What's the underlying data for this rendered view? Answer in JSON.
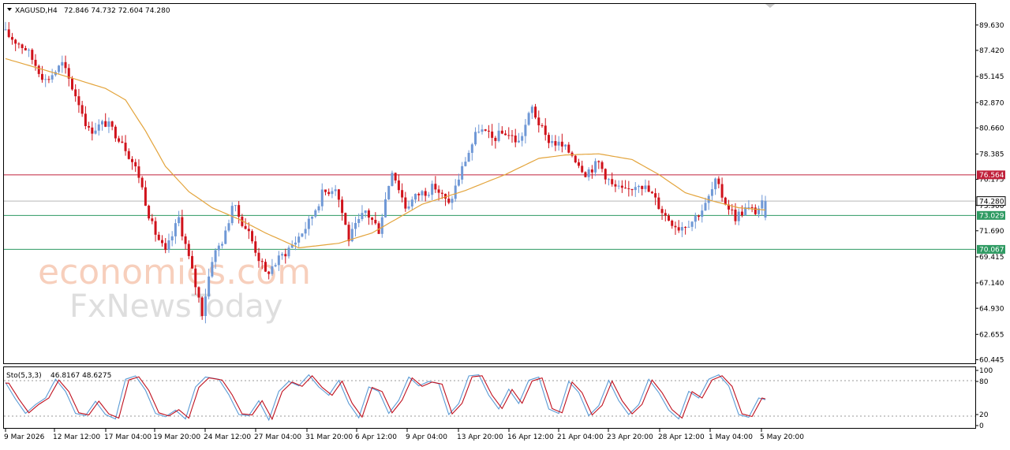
{
  "header": {
    "symbol_timeframe": "XAGUSD,H4",
    "ohlc": "72.846 74.732 72.604 74.280"
  },
  "watermark": {
    "line1": "economies.com",
    "line2": "FxNewsToday"
  },
  "colors": {
    "bull": "#6f98d6",
    "bear": "#d0121b",
    "moving_average": "#e3a43c",
    "resistance": "#c0213b",
    "support": "#2e9a62",
    "current_price": "#b8b8b8",
    "stoch_main": "#5b9bd5",
    "stoch_signal": "#c0101e"
  },
  "chart_data": [
    {
      "type": "candlestick",
      "title": "XAGUSD,H4",
      "ohlc_last": {
        "open": 72.846,
        "high": 74.732,
        "low": 72.604,
        "close": 74.28
      },
      "y_ticks": [
        89.63,
        87.42,
        85.145,
        82.87,
        80.66,
        78.385,
        76.175,
        73.9,
        71.69,
        69.415,
        67.14,
        64.93,
        62.655,
        60.445
      ],
      "ylim": [
        60.2,
        91.4
      ],
      "x_ticks": [
        "9 Mar 2026",
        "12 Mar 12:00",
        "17 Mar 04:00",
        "19 Mar 20:00",
        "24 Mar 12:00",
        "27 Mar 04:00",
        "31 Mar 20:00",
        "6 Apr 12:00",
        "9 Apr 04:00",
        "13 Apr 20:00",
        "16 Apr 12:00",
        "21 Apr 04:00",
        "23 Apr 20:00",
        "28 Apr 12:00",
        "1 May 04:00",
        "5 May 20:00"
      ],
      "close_path": [
        [
          0,
          88.9
        ],
        [
          6,
          87.6
        ],
        [
          12,
          84.8
        ],
        [
          17,
          86.2
        ],
        [
          22,
          82.9
        ],
        [
          25,
          80.4
        ],
        [
          30,
          81.1
        ],
        [
          35,
          79.6
        ],
        [
          40,
          76.5
        ],
        [
          44,
          72.1
        ],
        [
          48,
          69.7
        ],
        [
          52,
          72.8
        ],
        [
          56,
          68.1
        ],
        [
          59,
          64.6
        ],
        [
          62,
          69.3
        ],
        [
          66,
          71.4
        ],
        [
          68,
          74.0
        ],
        [
          73,
          71.5
        ],
        [
          78,
          67.9
        ],
        [
          82,
          69.2
        ],
        [
          87,
          70.8
        ],
        [
          91,
          72.4
        ],
        [
          95,
          74.9
        ],
        [
          99,
          75.6
        ],
        [
          103,
          71.0
        ],
        [
          108,
          73.4
        ],
        [
          112,
          71.8
        ],
        [
          116,
          77.1
        ],
        [
          120,
          73.8
        ],
        [
          124,
          74.9
        ],
        [
          129,
          75.5
        ],
        [
          133,
          73.9
        ],
        [
          138,
          77.9
        ],
        [
          142,
          80.6
        ],
        [
          146,
          79.7
        ],
        [
          150,
          80.3
        ],
        [
          154,
          79.4
        ],
        [
          158,
          82.4
        ],
        [
          162,
          79.8
        ],
        [
          166,
          79.2
        ],
        [
          170,
          78.4
        ],
        [
          174,
          76.8
        ],
        [
          178,
          77.6
        ],
        [
          182,
          75.6
        ],
        [
          186,
          75.0
        ],
        [
          190,
          76.0
        ],
        [
          194,
          74.8
        ],
        [
          198,
          73.0
        ],
        [
          202,
          72.0
        ],
        [
          206,
          72.6
        ],
        [
          210,
          73.9
        ],
        [
          213,
          75.9
        ],
        [
          216,
          74.2
        ],
        [
          219,
          72.9
        ],
        [
          222,
          73.6
        ],
        [
          225,
          73.4
        ],
        [
          228,
          74.28
        ]
      ],
      "moving_average_path": [
        [
          0,
          86.7
        ],
        [
          20,
          85.0
        ],
        [
          30,
          84.1
        ],
        [
          36,
          83.1
        ],
        [
          42,
          80.4
        ],
        [
          48,
          77.3
        ],
        [
          55,
          75.1
        ],
        [
          62,
          73.7
        ],
        [
          70,
          72.7
        ],
        [
          78,
          71.5
        ],
        [
          88,
          70.2
        ],
        [
          100,
          70.6
        ],
        [
          110,
          71.5
        ],
        [
          125,
          74.0
        ],
        [
          138,
          75.2
        ],
        [
          150,
          76.6
        ],
        [
          160,
          78.0
        ],
        [
          168,
          78.3
        ],
        [
          178,
          78.4
        ],
        [
          188,
          77.9
        ],
        [
          196,
          76.6
        ],
        [
          204,
          75.0
        ],
        [
          212,
          74.3
        ],
        [
          220,
          73.7
        ],
        [
          228,
          73.5
        ]
      ],
      "horizontal_levels": [
        {
          "name": "resistance",
          "price": 76.564,
          "label": "76.564"
        },
        {
          "name": "current",
          "price": 74.28,
          "label": "74.280"
        },
        {
          "name": "support-1",
          "price": 73.029,
          "label": "73.029"
        },
        {
          "name": "support-2",
          "price": 70.067,
          "label": "70.067"
        }
      ]
    },
    {
      "type": "line",
      "title": "Sto(5,3,3)",
      "values_text": "46.8167 48.6275",
      "y_ticks": [
        100,
        80,
        20,
        0
      ],
      "ylim": [
        0,
        100
      ],
      "levels": [
        20,
        80
      ],
      "main_anchors": [
        [
          0,
          78
        ],
        [
          3,
          48
        ],
        [
          6,
          22
        ],
        [
          9,
          38
        ],
        [
          12,
          50
        ],
        [
          15,
          84
        ],
        [
          18,
          62
        ],
        [
          21,
          22
        ],
        [
          24,
          18
        ],
        [
          27,
          44
        ],
        [
          30,
          20
        ],
        [
          33,
          12
        ],
        [
          36,
          84
        ],
        [
          39,
          90
        ],
        [
          42,
          64
        ],
        [
          45,
          22
        ],
        [
          48,
          16
        ],
        [
          51,
          28
        ],
        [
          54,
          12
        ],
        [
          57,
          70
        ],
        [
          60,
          88
        ],
        [
          64,
          84
        ],
        [
          67,
          56
        ],
        [
          70,
          20
        ],
        [
          73,
          18
        ],
        [
          76,
          45
        ],
        [
          79,
          10
        ],
        [
          82,
          62
        ],
        [
          85,
          80
        ],
        [
          88,
          72
        ],
        [
          91,
          92
        ],
        [
          94,
          70
        ],
        [
          97,
          55
        ],
        [
          100,
          82
        ],
        [
          103,
          40
        ],
        [
          106,
          14
        ],
        [
          109,
          70
        ],
        [
          112,
          62
        ],
        [
          115,
          22
        ],
        [
          118,
          46
        ],
        [
          121,
          88
        ],
        [
          124,
          72
        ],
        [
          127,
          80
        ],
        [
          130,
          76
        ],
        [
          133,
          20
        ],
        [
          136,
          40
        ],
        [
          139,
          90
        ],
        [
          142,
          92
        ],
        [
          145,
          55
        ],
        [
          148,
          30
        ],
        [
          151,
          66
        ],
        [
          154,
          40
        ],
        [
          157,
          82
        ],
        [
          160,
          88
        ],
        [
          163,
          30
        ],
        [
          166,
          22
        ],
        [
          169,
          80
        ],
        [
          172,
          60
        ],
        [
          175,
          18
        ],
        [
          178,
          36
        ],
        [
          181,
          82
        ],
        [
          184,
          45
        ],
        [
          187,
          20
        ],
        [
          190,
          38
        ],
        [
          193,
          84
        ],
        [
          196,
          60
        ],
        [
          199,
          28
        ],
        [
          202,
          12
        ],
        [
          205,
          62
        ],
        [
          208,
          50
        ],
        [
          211,
          84
        ],
        [
          214,
          92
        ],
        [
          217,
          72
        ],
        [
          220,
          20
        ],
        [
          223,
          15
        ],
        [
          226,
          50
        ],
        [
          228,
          46.8
        ]
      ],
      "signal_lag": 1
    }
  ]
}
